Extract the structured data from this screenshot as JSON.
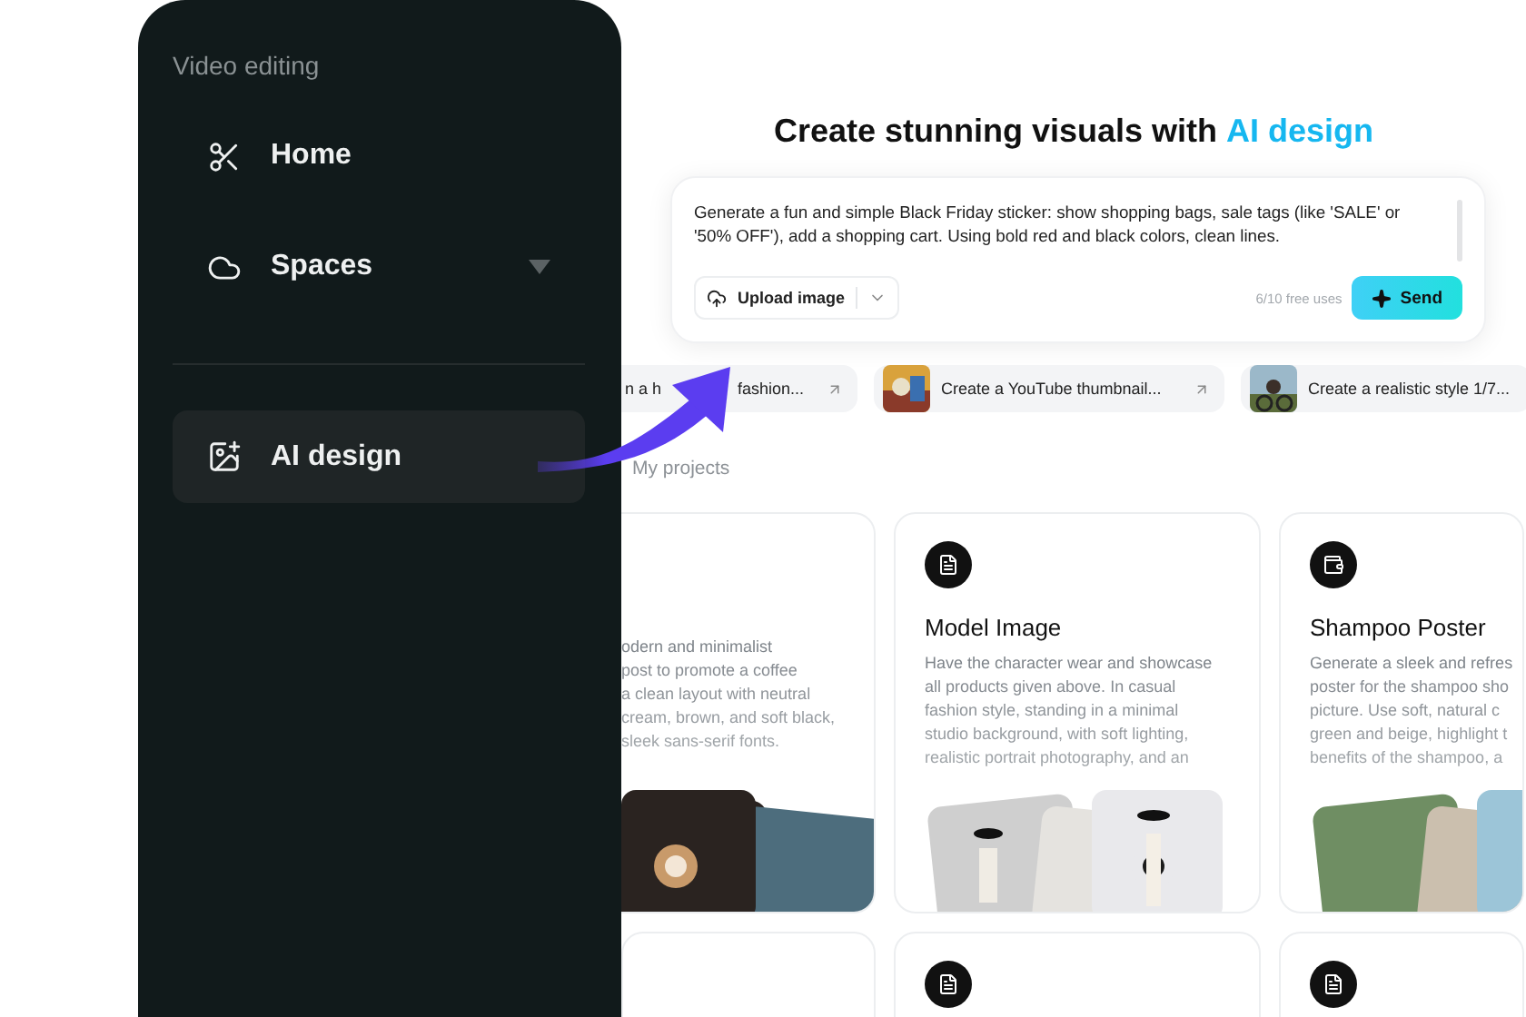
{
  "sidebar": {
    "section_label": "Video editing",
    "groups": [
      [
        {
          "label": "Home",
          "selected": false,
          "expandable": false
        },
        {
          "label": "Spaces",
          "selected": false,
          "expandable": true
        }
      ],
      [
        {
          "label": "AI design",
          "selected": true,
          "expandable": false
        }
      ]
    ]
  },
  "main": {
    "title": "Create stunning visuals with ",
    "title_highlight": "AI design",
    "prompt": {
      "value": "Generate a fun and simple Black Friday sticker: show shopping bags, sale tags (like 'SALE' or '50% OFF'), add a shopping cart. Using bold red and black colors, clean lines.",
      "upload_label": "Upload image",
      "usage": "6/10 free uses",
      "send_label": "Send"
    },
    "suggestions": [
      {
        "prefix": "n a h",
        "label": "fashion...",
        "thumbnail": false
      },
      {
        "label": "Create a YouTube thumbnail...",
        "thumbnail": true
      },
      {
        "label": "Create a realistic style 1/7...",
        "thumbnail": true
      }
    ],
    "section_title": "My projects",
    "cards": [
      {
        "has_icon": false,
        "lines": [
          "odern and minimalist",
          "post to promote a coffee",
          "a clean layout with neutral",
          "cream, brown, and soft black,",
          "sleek sans-serif fonts."
        ]
      },
      {
        "has_icon": true,
        "title": "Model Image",
        "lines": [
          "Have the character wear and showcase",
          "all products given above. In casual",
          "fashion style, standing in a minimal",
          "studio background, with soft lighting,",
          "realistic portrait photography, and an"
        ]
      },
      {
        "has_icon": true,
        "title": "Shampoo Poster",
        "lines": [
          "Generate a sleek and refres",
          "poster for the shampoo sho",
          "picture. Use soft, natural c",
          "green and beige, highlight t",
          "benefits of the shampoo, a"
        ]
      }
    ],
    "next_row_cards": [
      {
        "has_icon": false
      },
      {
        "has_icon": true
      },
      {
        "has_icon": true
      }
    ]
  }
}
